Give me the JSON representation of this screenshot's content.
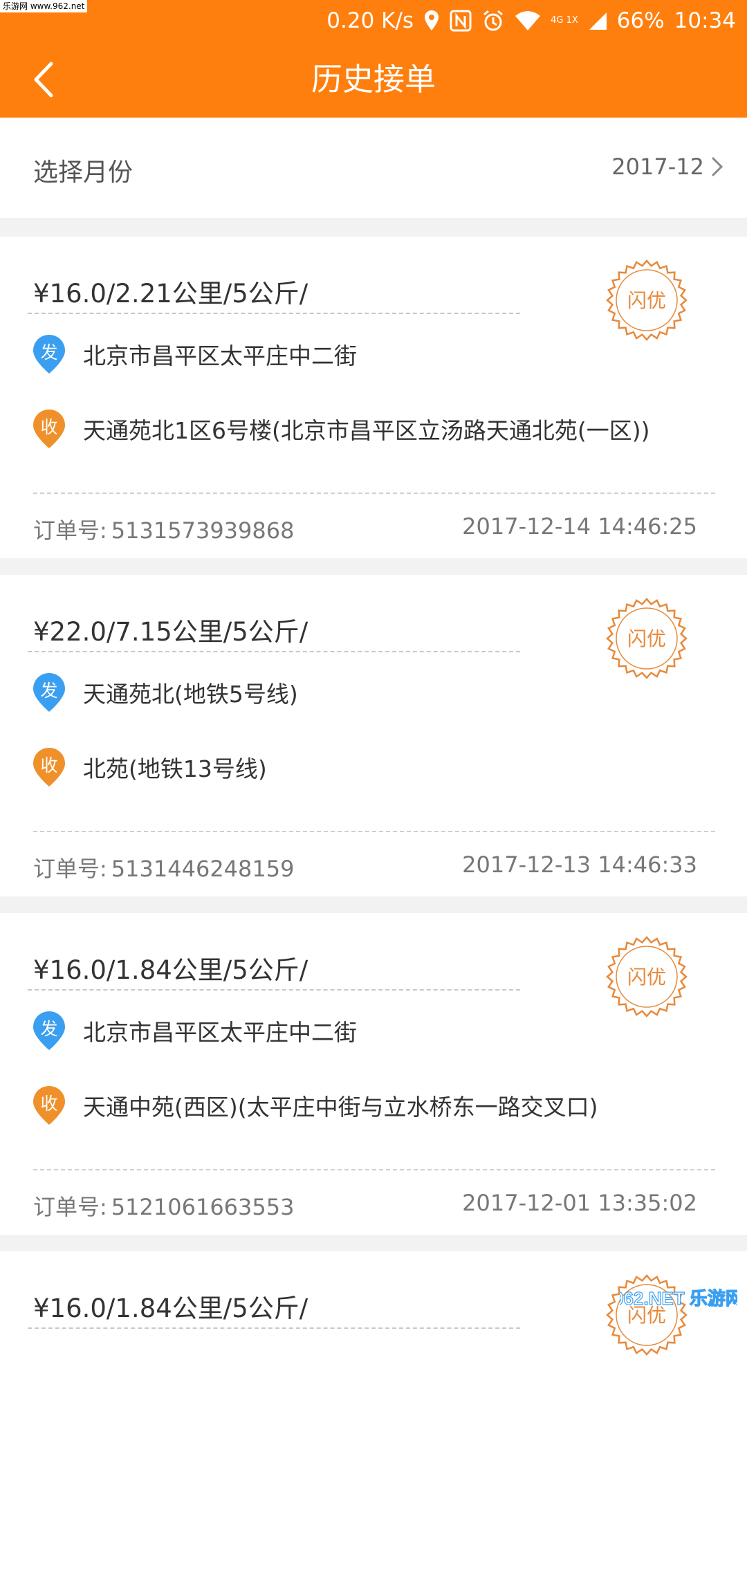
{
  "status_bar": {
    "watermark": "乐游网 www.962.net",
    "speed": "0.20 K/s",
    "network": "4G 1X",
    "battery": "66%",
    "time": "10:34"
  },
  "header": {
    "title": "历史接单",
    "back_icon": "chevron-left-icon",
    "color": "#ff7f0e"
  },
  "month_selector": {
    "label": "选择月份",
    "value": "2017-12"
  },
  "labels": {
    "send_badge": "发",
    "receive_badge": "收",
    "stamp": "闪优",
    "order_prefix": "订单号:"
  },
  "orders": [
    {
      "summary": "¥16.0/2.21公里/5公斤/",
      "from": "北京市昌平区太平庄中二街",
      "to": "天通苑北1区6号楼(北京市昌平区立汤路天通北苑(一区))",
      "order_no": "5131573939868",
      "time": "2017-12-14 14:46:25"
    },
    {
      "summary": "¥22.0/7.15公里/5公斤/",
      "from": "天通苑北(地铁5号线)",
      "to": "北苑(地铁13号线)",
      "order_no": "5131446248159",
      "time": "2017-12-13 14:46:33"
    },
    {
      "summary": "¥16.0/1.84公里/5公斤/",
      "from": "北京市昌平区太平庄中二街",
      "to": "天通中苑(西区)(太平庄中街与立水桥东一路交叉口)",
      "order_no": "5121061663553",
      "time": "2017-12-01 13:35:02"
    },
    {
      "summary": "¥16.0/1.84公里/5公斤/"
    }
  ],
  "corner_watermark": "962.NET 乐游网",
  "colors": {
    "accent": "#ff7f0e",
    "send_pin": "#3a9ff0",
    "receive_pin": "#f0902a",
    "stamp": "#e8893a"
  }
}
